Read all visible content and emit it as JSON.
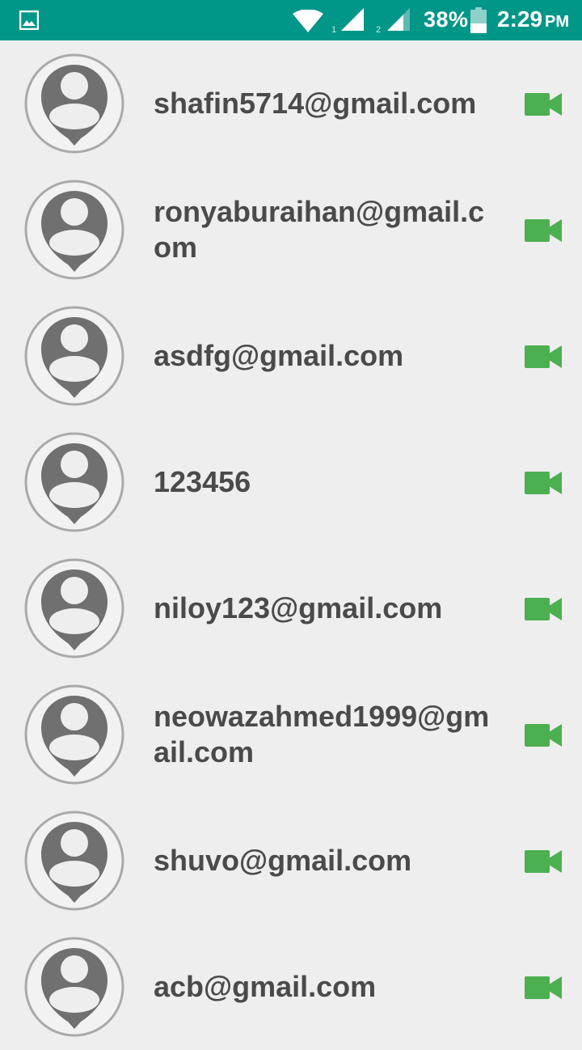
{
  "status_bar": {
    "battery_percent": "38%",
    "time": "2:29",
    "ampm": "PM",
    "color": "#009688",
    "sim1_label": "1",
    "sim2_label": "2",
    "icons": [
      "gallery-icon",
      "wifi-icon",
      "signal-icon",
      "battery-icon"
    ]
  },
  "contacts": [
    {
      "name": "shafin5714@gmail.com"
    },
    {
      "name": "ronyaburaihan@gmail.com"
    },
    {
      "name": "asdfg@gmail.com"
    },
    {
      "name": "123456"
    },
    {
      "name": "niloy123@gmail.com"
    },
    {
      "name": "neowazahmed1999@gmail.com"
    },
    {
      "name": "shuvo@gmail.com"
    },
    {
      "name": "acb@gmail.com"
    }
  ],
  "colors": {
    "video_icon": "#4caf50",
    "avatar": "#707070",
    "text": "#4a4a4a",
    "background": "#eeeeee"
  }
}
